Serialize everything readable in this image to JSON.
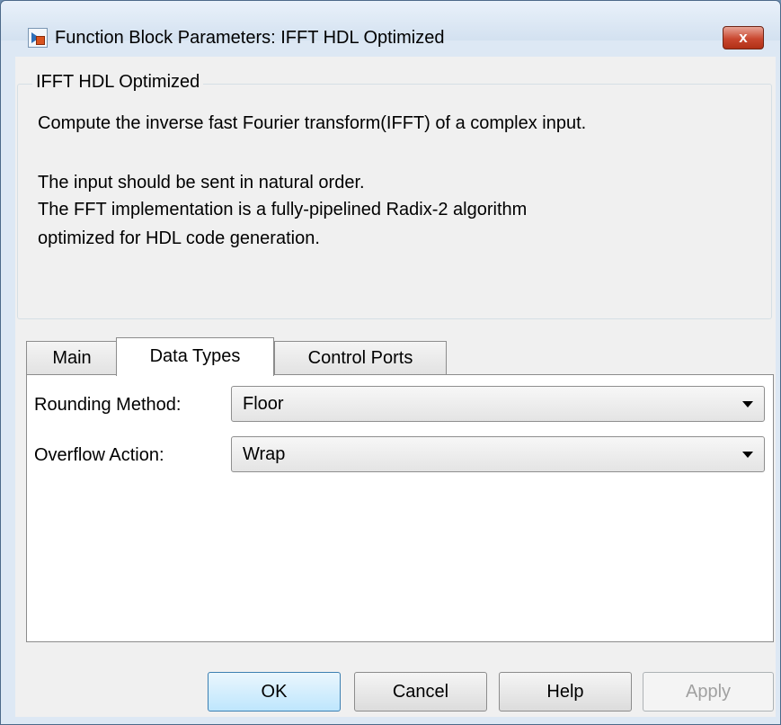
{
  "window": {
    "title": "Function Block Parameters: IFFT HDL Optimized",
    "close_symbol": "x"
  },
  "group": {
    "legend": "IFFT HDL Optimized",
    "lines": [
      "Compute the inverse fast Fourier transform(IFFT) of a complex input.",
      "",
      "The input should be sent in natural order.",
      "The FFT implementation is a fully-pipelined Radix-2 algorithm",
      "optimized for HDL code generation."
    ]
  },
  "tabs": [
    {
      "label": "Main"
    },
    {
      "label": "Data Types",
      "active": true
    },
    {
      "label": "Control Ports"
    }
  ],
  "fields": {
    "rounding": {
      "label": "Rounding Method:",
      "value": "Floor"
    },
    "overflow": {
      "label": "Overflow Action:",
      "value": "Wrap"
    }
  },
  "buttons": {
    "ok": "OK",
    "cancel": "Cancel",
    "help": "Help",
    "apply": "Apply"
  },
  "icons": {
    "app": "simulink-block-icon",
    "close": "close-icon",
    "dropdown": "chevron-down-icon"
  },
  "colors": {
    "titlebar": "#dde8f4",
    "close_button": "#c9472f",
    "default_button": "#bee6fd"
  }
}
